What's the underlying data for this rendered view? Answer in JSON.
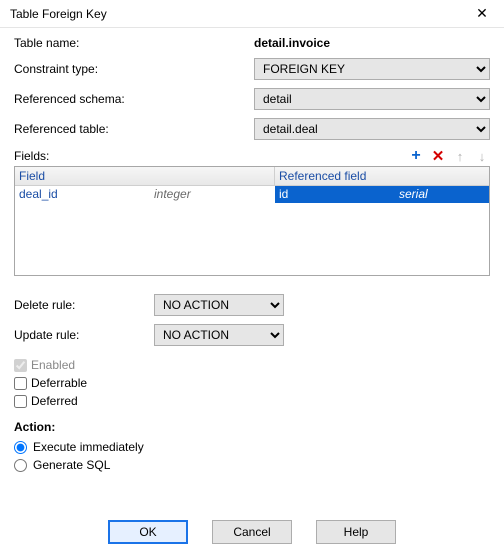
{
  "titlebar": {
    "title": "Table Foreign Key"
  },
  "form": {
    "table_name_label": "Table name:",
    "table_name_value": "detail.invoice",
    "constraint_type_label": "Constraint type:",
    "constraint_type_value": "FOREIGN KEY",
    "ref_schema_label": "Referenced schema:",
    "ref_schema_value": "detail",
    "ref_table_label": "Referenced table:",
    "ref_table_value": "detail.deal",
    "fields_label": "Fields:"
  },
  "grid": {
    "headers": {
      "field": "Field",
      "referenced_field": "Referenced field"
    },
    "row": {
      "field_name": "deal_id",
      "field_type": "integer",
      "ref_name": "id",
      "ref_type": "serial"
    }
  },
  "rules": {
    "delete_label": "Delete rule:",
    "delete_value": "NO ACTION",
    "update_label": "Update rule:",
    "update_value": "NO ACTION"
  },
  "checks": {
    "enabled": "Enabled",
    "deferrable": "Deferrable",
    "deferred": "Deferred"
  },
  "action": {
    "label": "Action:",
    "execute": "Execute immediately",
    "generate": "Generate SQL"
  },
  "buttons": {
    "ok": "OK",
    "cancel": "Cancel",
    "help": "Help"
  }
}
